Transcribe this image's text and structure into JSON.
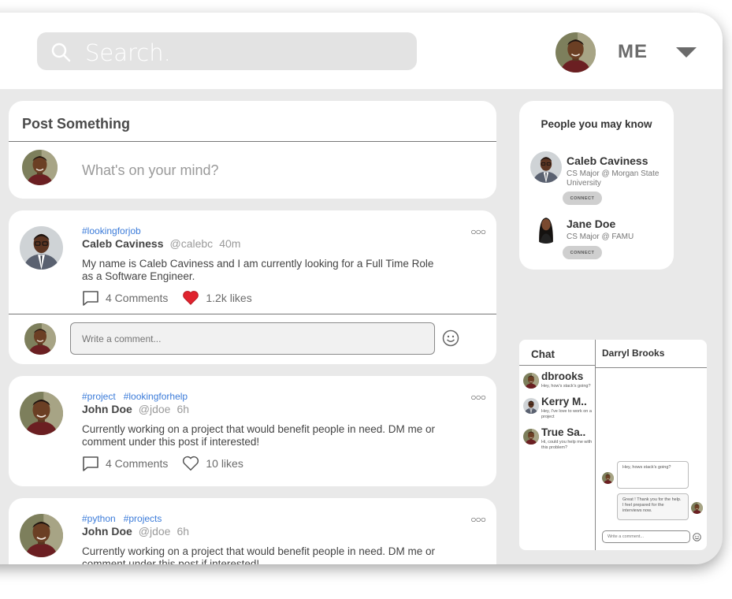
{
  "header": {
    "search_placeholder": "Search.",
    "profile_label": "ME"
  },
  "post_box": {
    "title": "Post Something",
    "placeholder": "What's on your mind?"
  },
  "posts": [
    {
      "tags": [
        "#lookingforjob"
      ],
      "author": "Caleb Caviness",
      "handle": "@calebc",
      "time": "40m",
      "body": "My name is Caleb Caviness and I am currently looking for a Full Time Role as a Software Engineer.",
      "comments": "4 Comments",
      "likes": "1.2k likes",
      "liked": true,
      "comment_placeholder": "Write a comment..."
    },
    {
      "tags": [
        "#project",
        "#lookingforhelp"
      ],
      "author": "John Doe",
      "handle": "@jdoe",
      "time": "6h",
      "body": "Currently working on a project that would benefit  people in need. DM me or comment under this post if interested!",
      "comments": "4 Comments",
      "likes": "10 likes",
      "liked": false
    },
    {
      "tags": [
        "#python",
        "#projects"
      ],
      "author": "John Doe",
      "handle": "@jdoe",
      "time": "6h",
      "body": "Currently working on a project that would benefit  people in need. DM me or comment under this post if interested!"
    }
  ],
  "people_you_may_know": {
    "title": "People you may know",
    "people": [
      {
        "name": "Caleb Caviness",
        "subtitle": "CS Major @ Morgan State University",
        "button": "CONNECT"
      },
      {
        "name": "Jane Doe",
        "subtitle": "CS Major @ FAMU",
        "button": "CONNECT"
      }
    ]
  },
  "chat": {
    "title": "Chat",
    "active_partner": "Darryl Brooks",
    "contacts": [
      {
        "name": "dbrooks",
        "preview": "Hey, how's stack's going?"
      },
      {
        "name": "Kerry M..",
        "preview": "Hey, I've love to work on a project"
      },
      {
        "name": "True Sa..",
        "preview": "Hi, could you help me with this problem?"
      }
    ],
    "messages": [
      {
        "from": "them",
        "text": "Hey, hows stack's going?"
      },
      {
        "from": "me",
        "text": "Great ! Thank you for the help. I feel prepared for the interviews now."
      }
    ],
    "input_placeholder": "Write a comment..."
  },
  "colors": {
    "accent_link": "#3b7bd9",
    "like_red": "#e0232e",
    "background": "#e9e9e9"
  }
}
